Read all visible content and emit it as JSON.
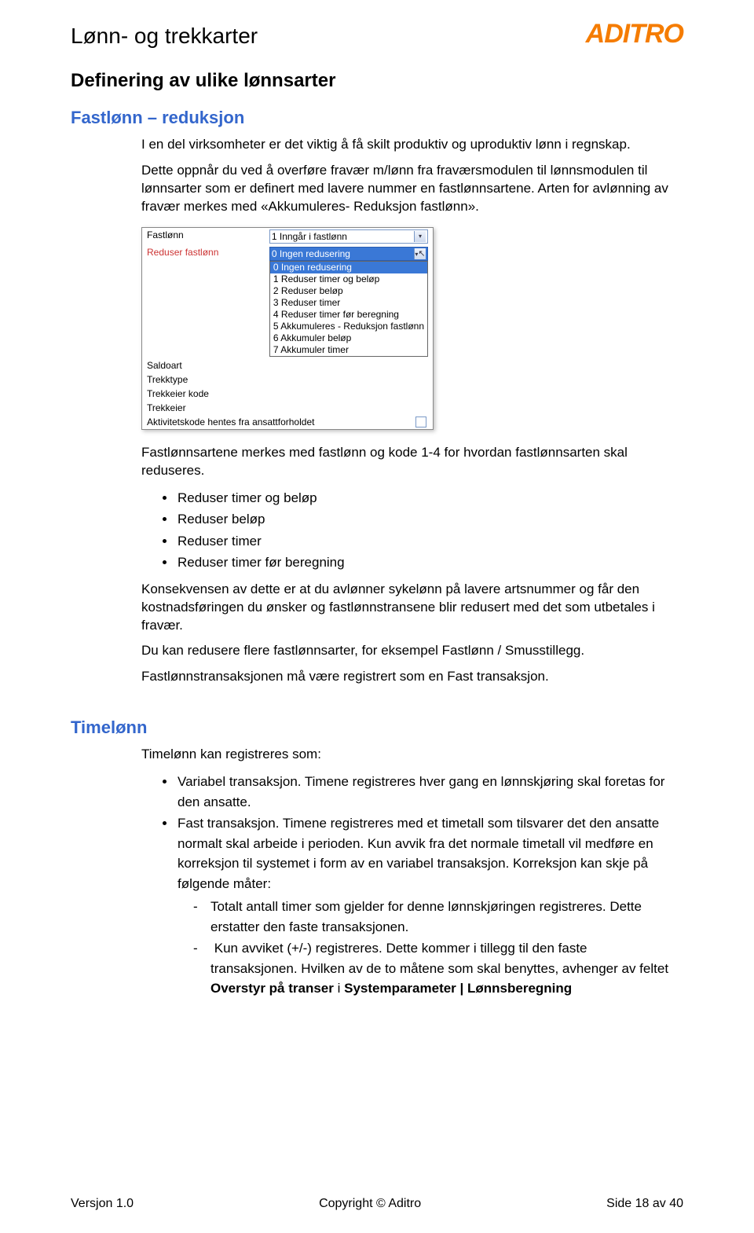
{
  "header": {
    "doc_title": "Lønn- og trekkarter",
    "brand": "ADITRO"
  },
  "section1": {
    "heading": "Definering av ulike lønnsarter",
    "subheading": "Fastlønn – reduksjon",
    "p1": "I en del virksomheter er det viktig å få skilt produktiv og uproduktiv lønn i regnskap.",
    "p2": "Dette oppnår du ved å overføre fravær m/lønn fra fraværsmodulen til lønnsmodulen til lønnsarter som er definert med lavere nummer en fastlønnsartene. Arten for avlønning av fravær merkes med «Akkumuleres- Reduksjon fastlønn».",
    "p3": "Fastlønnsartene merkes med fastlønn og kode 1-4 for hvordan fastlønnsarten skal reduseres.",
    "bullets1": [
      "Reduser timer og beløp",
      "Reduser beløp",
      "Reduser timer",
      "Reduser timer før beregning"
    ],
    "p4": "Konsekvensen av dette er at du avlønner sykelønn på lavere artsnummer og får den kostnadsføringen du ønsker og fastlønnstransene blir redusert med det som utbetales i fravær.",
    "p5": "Du kan redusere flere fastlønnsarter, for eksempel Fastlønn / Smusstillegg.",
    "p6": "Fastlønnstransaksjonen må være registrert som en Fast transaksjon."
  },
  "screenshot": {
    "rows": [
      {
        "label": "Fastlønn",
        "value": "1 Inngår i fastlønn"
      },
      {
        "label": "Reduser fastlønn",
        "value": "0 Ingen redusering",
        "highlight": true,
        "dropdown": [
          "0 Ingen redusering",
          "1 Reduser timer og beløp",
          "2 Reduser beløp",
          "3 Reduser timer",
          "4 Reduser timer før beregning",
          "5 Akkumuleres - Reduksjon fastlønn",
          "6 Akkumuler beløp",
          "7 Akkumuler timer"
        ]
      },
      {
        "label": "Saldoart",
        "value": ""
      },
      {
        "label": "Trekktype",
        "value": ""
      },
      {
        "label": "Trekkeier kode",
        "value": ""
      },
      {
        "label": "Trekkeier",
        "value": ""
      },
      {
        "label": "Aktivitetskode hentes fra ansattforholdet",
        "value": "",
        "checkbox": true
      }
    ]
  },
  "section2": {
    "heading": "Timelønn",
    "p1": "Timelønn kan registreres som:",
    "bullets": [
      {
        "text": "Variabel transaksjon. Timene registreres hver gang en lønnskjøring skal foretas for den ansatte."
      },
      {
        "text_pre": "Fast transaksjon. Timene registreres med et timetall som tilsvarer det den ansatte normalt skal arbeide i perioden. Kun avvik fra det normale timetall vil medføre en korreksjon til systemet i form av en variabel transaksjon. Korreksjon kan skje på følgende måter:",
        "sub": [
          "Totalt antall timer som gjelder for denne lønnskjøringen registreres. Dette erstatter den faste transaksjonen.",
          {
            "pre": "Kun avviket (+/-) registreres. Dette kommer i tillegg til den faste transaksjonen. Hvilken av de to måtene som skal benyttes, avhenger av feltet ",
            "bold1": "Overstyr på transer",
            "mid": " i ",
            "bold2": "Systemparameter | Lønnsberegning"
          }
        ]
      }
    ]
  },
  "footer": {
    "left": "Versjon 1.0",
    "center": "Copyright © Aditro",
    "right": "Side 18 av 40"
  }
}
